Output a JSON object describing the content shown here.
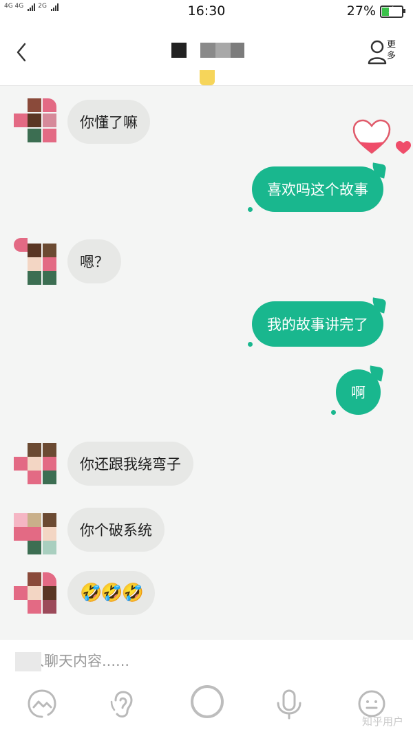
{
  "status_bar": {
    "network_left": "4G 4G",
    "network_right": "2G",
    "time": "16:30",
    "battery_percent": "27%",
    "battery_level": 0.27
  },
  "nav": {
    "more_label": "更多"
  },
  "messages": [
    {
      "side": "in",
      "text": "你懂了嘛"
    },
    {
      "side": "out",
      "text": "喜欢吗这个故事"
    },
    {
      "side": "in",
      "text": "嗯？"
    },
    {
      "side": "out",
      "text": "我的故事讲完了"
    },
    {
      "side": "out",
      "text": "啊"
    },
    {
      "side": "in",
      "text": "你还跟我绕弯子"
    },
    {
      "side": "in",
      "text": "你个破系统"
    },
    {
      "side": "in",
      "text": "🤣🤣🤣"
    }
  ],
  "input": {
    "placeholder": "输入聊天内容......"
  },
  "toolbar": {
    "icons": [
      "image-icon",
      "ear-icon",
      "record-circle-icon",
      "microphone-icon",
      "emoji-face-icon"
    ]
  },
  "watermark": "知乎用户",
  "colors": {
    "accent_green": "#19b78e",
    "incoming_bubble": "#e7e8e6",
    "background": "#f4f5f4"
  }
}
